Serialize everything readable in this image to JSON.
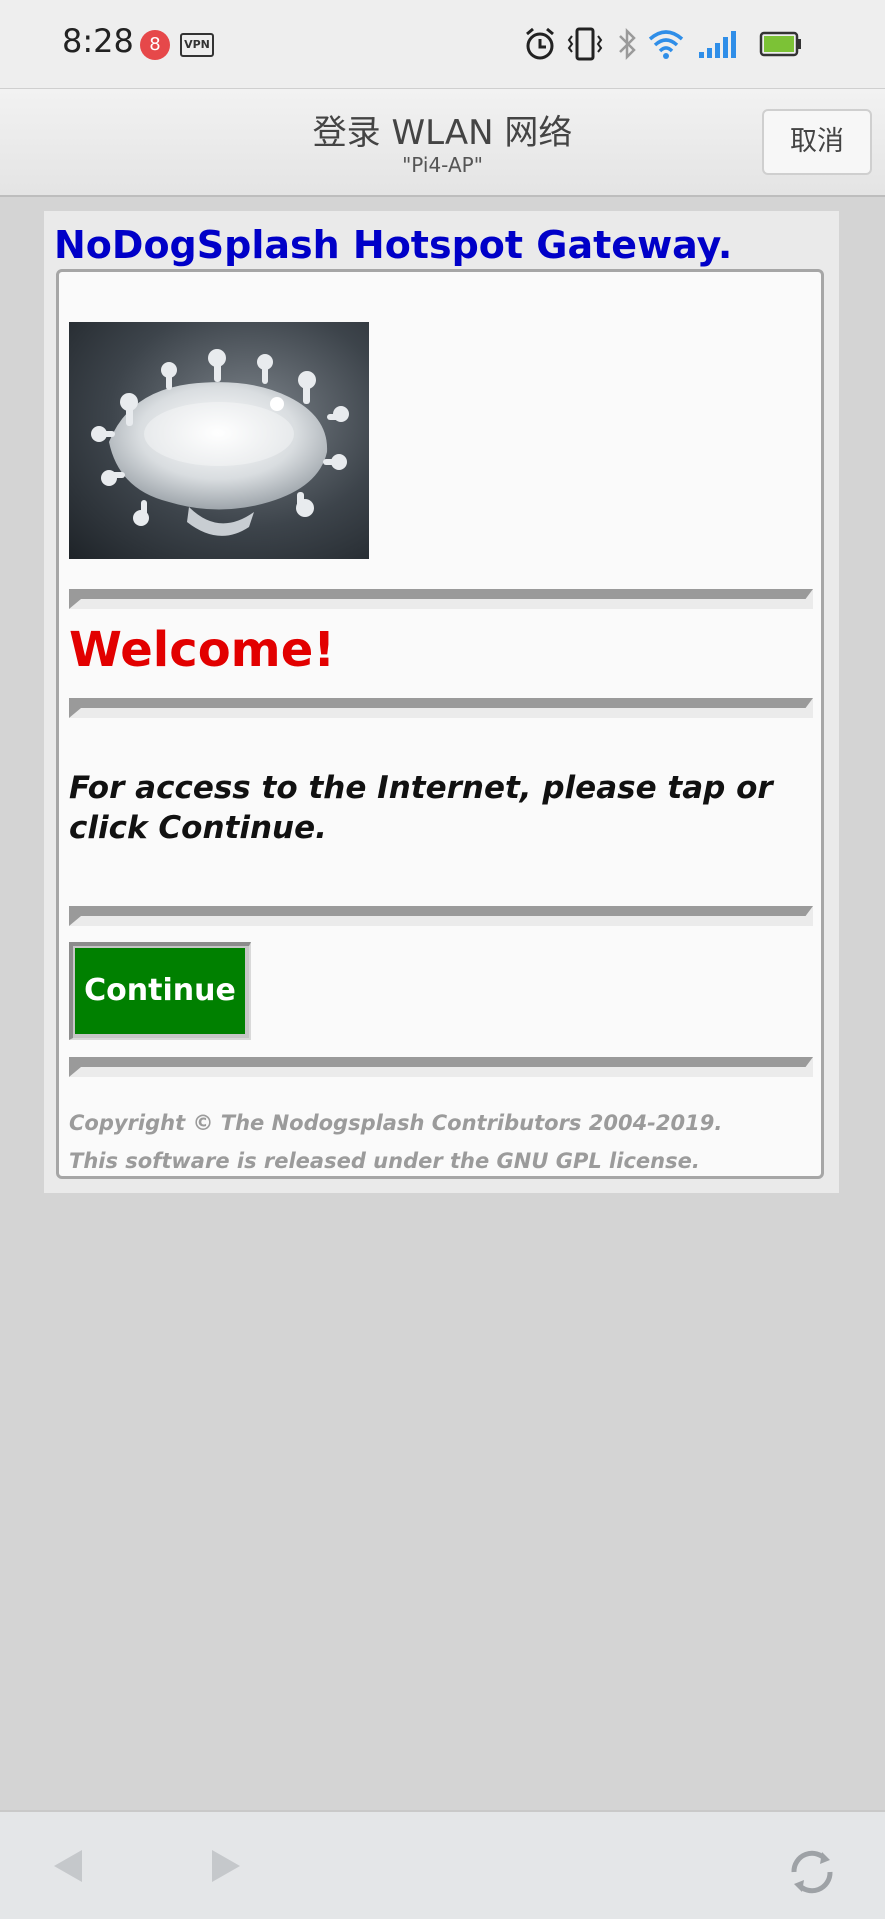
{
  "status_bar": {
    "time": "8:28",
    "notification_count": "8",
    "vpn_label": "VPN",
    "icons": [
      "alarm-icon",
      "vibrate-icon",
      "bluetooth-icon",
      "wifi-icon",
      "signal-icon",
      "battery-icon"
    ],
    "colors": {
      "battery": "#7cc236",
      "wifi": "#2f8ee8",
      "badge": "#e6484a"
    }
  },
  "title_bar": {
    "title": "登录 WLAN 网络",
    "subtitle": "\"Pi4-AP\"",
    "cancel_label": "取消"
  },
  "portal": {
    "gateway_title": "NoDogSplash Hotspot Gateway.",
    "welcome": "Welcome!",
    "access_text": "For access to the Internet, please tap or click Continue.",
    "continue_label": "Continue",
    "copyright_line1": "Copyright © The Nodogsplash Contributors 2004-2019.",
    "copyright_line2": "This software is released under the GNU GPL license.",
    "colors": {
      "title": "#0000c8",
      "welcome": "#e20000",
      "button": "#008000"
    }
  },
  "bottom_bar": {
    "icons": [
      "back-arrow-icon",
      "forward-arrow-icon",
      "refresh-icon"
    ]
  }
}
